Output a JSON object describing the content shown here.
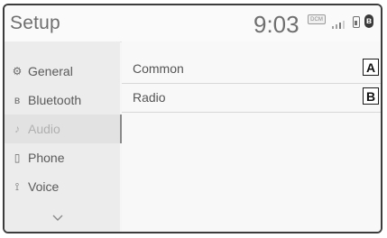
{
  "header": {
    "title": "Setup",
    "time": "9:03",
    "dcm_label": "DCM"
  },
  "sidebar": {
    "items": [
      {
        "label": "General",
        "icon": "gear-icon",
        "glyph": "⚙",
        "active": false
      },
      {
        "label": "Bluetooth",
        "icon": "bluetooth-icon",
        "glyph": "ʙ",
        "active": false
      },
      {
        "label": "Audio",
        "icon": "music-note-icon",
        "glyph": "♪",
        "active": true
      },
      {
        "label": "Phone",
        "icon": "phone-icon",
        "glyph": "▯",
        "active": false
      },
      {
        "label": "Voice",
        "icon": "voice-icon",
        "glyph": "⟟",
        "active": false
      }
    ]
  },
  "main": {
    "rows": [
      {
        "label": "Common",
        "badge": "A"
      },
      {
        "label": "Radio",
        "badge": "B"
      }
    ]
  }
}
